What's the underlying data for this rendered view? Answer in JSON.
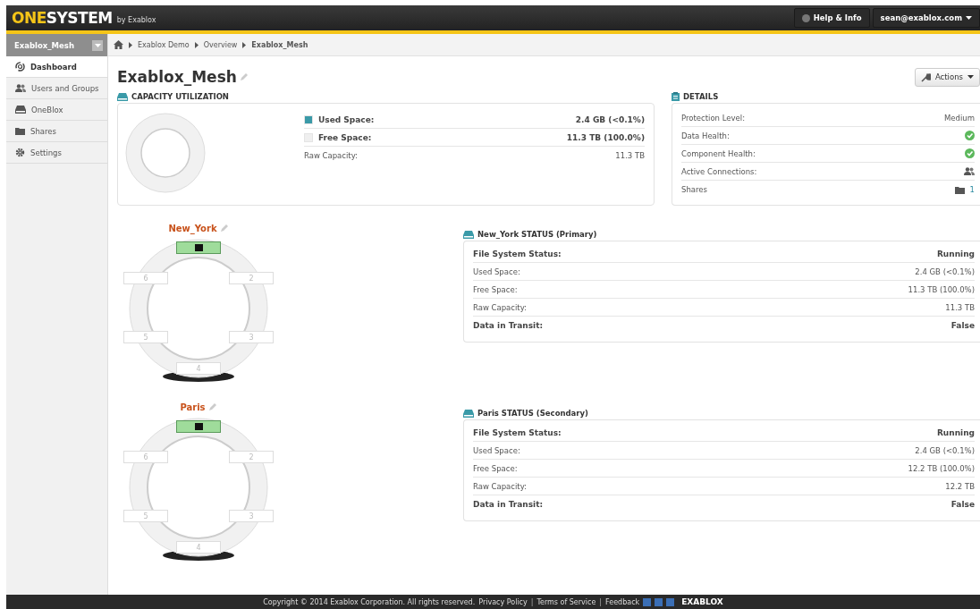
{
  "header": {
    "logo_first": "ONE",
    "logo_second": "SYSTEM",
    "byline": "by Exablox",
    "help": "Help & Info",
    "user": "sean@exablox.com"
  },
  "sidebar": {
    "mesh": "Exablox_Mesh",
    "items": [
      {
        "label": "Dashboard",
        "kind": "dashboard",
        "selected": true
      },
      {
        "label": "Users and Groups",
        "kind": "users",
        "selected": false
      },
      {
        "label": "OneBlox",
        "kind": "drive",
        "selected": false
      },
      {
        "label": "Shares",
        "kind": "folder",
        "selected": false
      },
      {
        "label": "Settings",
        "kind": "gear",
        "selected": false
      }
    ]
  },
  "breadcrumb": [
    "Exablox Demo",
    "Overview",
    "Exablox_Mesh"
  ],
  "title": "Exablox_Mesh",
  "actions": "Actions",
  "capacity": {
    "heading": "CAPACITY UTILIZATION",
    "rows": [
      {
        "label": "Used Space:",
        "value": "2.4 GB (<0.1%)",
        "kind": "legend",
        "color": "#3a9aa8"
      },
      {
        "label": "Free Space:",
        "value": "11.3 TB (100.0%)",
        "kind": "legend",
        "color": "#efefef"
      },
      {
        "label": "Raw Capacity:",
        "value": "11.3 TB",
        "kind": "plain"
      }
    ]
  },
  "details": {
    "heading": "DETAILS",
    "rows": [
      {
        "label": "Protection Level:",
        "kind": "text",
        "value": "Medium"
      },
      {
        "label": "Data Health:",
        "kind": "check"
      },
      {
        "label": "Component Health:",
        "kind": "check"
      },
      {
        "label": "Active Connections:",
        "kind": "people"
      },
      {
        "label": "Shares",
        "kind": "shares",
        "value": "1"
      }
    ]
  },
  "nodes": [
    {
      "name": "New_York",
      "status_heading": "New_York STATUS (Primary)",
      "slots": [
        {
          "kind": "drive"
        },
        {
          "kind": "empty",
          "label": "2"
        },
        {
          "kind": "empty",
          "label": "3"
        },
        {
          "kind": "empty",
          "label": "4"
        },
        {
          "kind": "empty",
          "label": "5"
        },
        {
          "kind": "empty",
          "label": "6"
        }
      ],
      "rows": [
        {
          "label": "File System Status:",
          "value": "Running",
          "emphasis": true
        },
        {
          "label": "Used Space:",
          "value": "2.4 GB (<0.1%)",
          "emphasis": false
        },
        {
          "label": "Free Space:",
          "value": "11.3 TB (100.0%)",
          "emphasis": false
        },
        {
          "label": "Raw Capacity:",
          "value": "11.3 TB",
          "emphasis": false
        },
        {
          "label": "Data in Transit:",
          "value": "False",
          "emphasis": true
        }
      ]
    },
    {
      "name": "Paris",
      "status_heading": "Paris STATUS (Secondary)",
      "slots": [
        {
          "kind": "drive"
        },
        {
          "kind": "empty",
          "label": "2"
        },
        {
          "kind": "empty",
          "label": "3"
        },
        {
          "kind": "empty",
          "label": "4"
        },
        {
          "kind": "empty",
          "label": "5"
        },
        {
          "kind": "empty",
          "label": "6"
        }
      ],
      "rows": [
        {
          "label": "File System Status:",
          "value": "Running",
          "emphasis": true
        },
        {
          "label": "Used Space:",
          "value": "2.4 GB (<0.1%)",
          "emphasis": false
        },
        {
          "label": "Free Space:",
          "value": "12.2 TB (100.0%)",
          "emphasis": false
        },
        {
          "label": "Raw Capacity:",
          "value": "12.2 TB",
          "emphasis": false
        },
        {
          "label": "Data in Transit:",
          "value": "False",
          "emphasis": true
        }
      ]
    }
  ],
  "footer": {
    "copyright": "Copyright © 2014 Exablox Corporation. All rights reserved.",
    "links": [
      {
        "kind": "link",
        "text": "Privacy Policy"
      },
      {
        "kind": "separator",
        "text": "|"
      },
      {
        "kind": "link",
        "text": "Terms of Service"
      },
      {
        "kind": "separator",
        "text": "|"
      },
      {
        "kind": "link",
        "text": "Feedback"
      }
    ],
    "logo": "EXABLOX"
  }
}
